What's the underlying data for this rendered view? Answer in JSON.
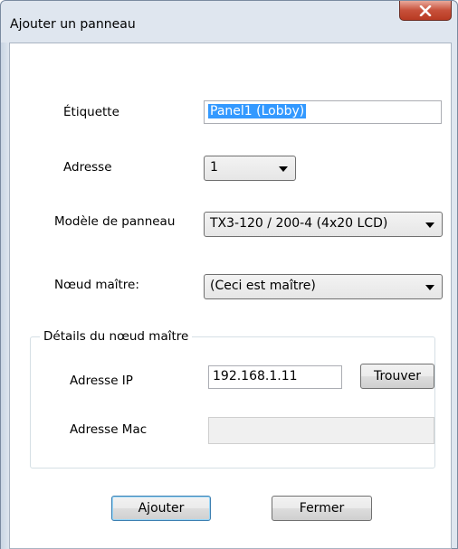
{
  "window": {
    "title": "Ajouter un panneau",
    "close_glyph": "X"
  },
  "form": {
    "label_etiquette": "Étiquette",
    "value_etiquette": "Panel1 (Lobby)",
    "label_adresse": "Adresse",
    "value_adresse": "1",
    "label_modele": "Modèle de panneau",
    "value_modele": "TX3-120 / 200-4 (4x20 LCD)",
    "label_noeud": "Nœud maître:",
    "value_noeud": "(Ceci est maître)"
  },
  "group": {
    "title": "Détails du nœud maître",
    "label_ip": "Adresse IP",
    "value_ip": "192.168.1.11",
    "find_button": "Trouver",
    "label_mac": "Adresse Mac",
    "value_mac": ""
  },
  "actions": {
    "add": "Ajouter",
    "close": "Fermer"
  },
  "icons": {
    "close": "close-icon",
    "dropdown": "chevron-down-icon"
  },
  "colors": {
    "selection": "#3399ff",
    "close_button": "#c7503a"
  }
}
